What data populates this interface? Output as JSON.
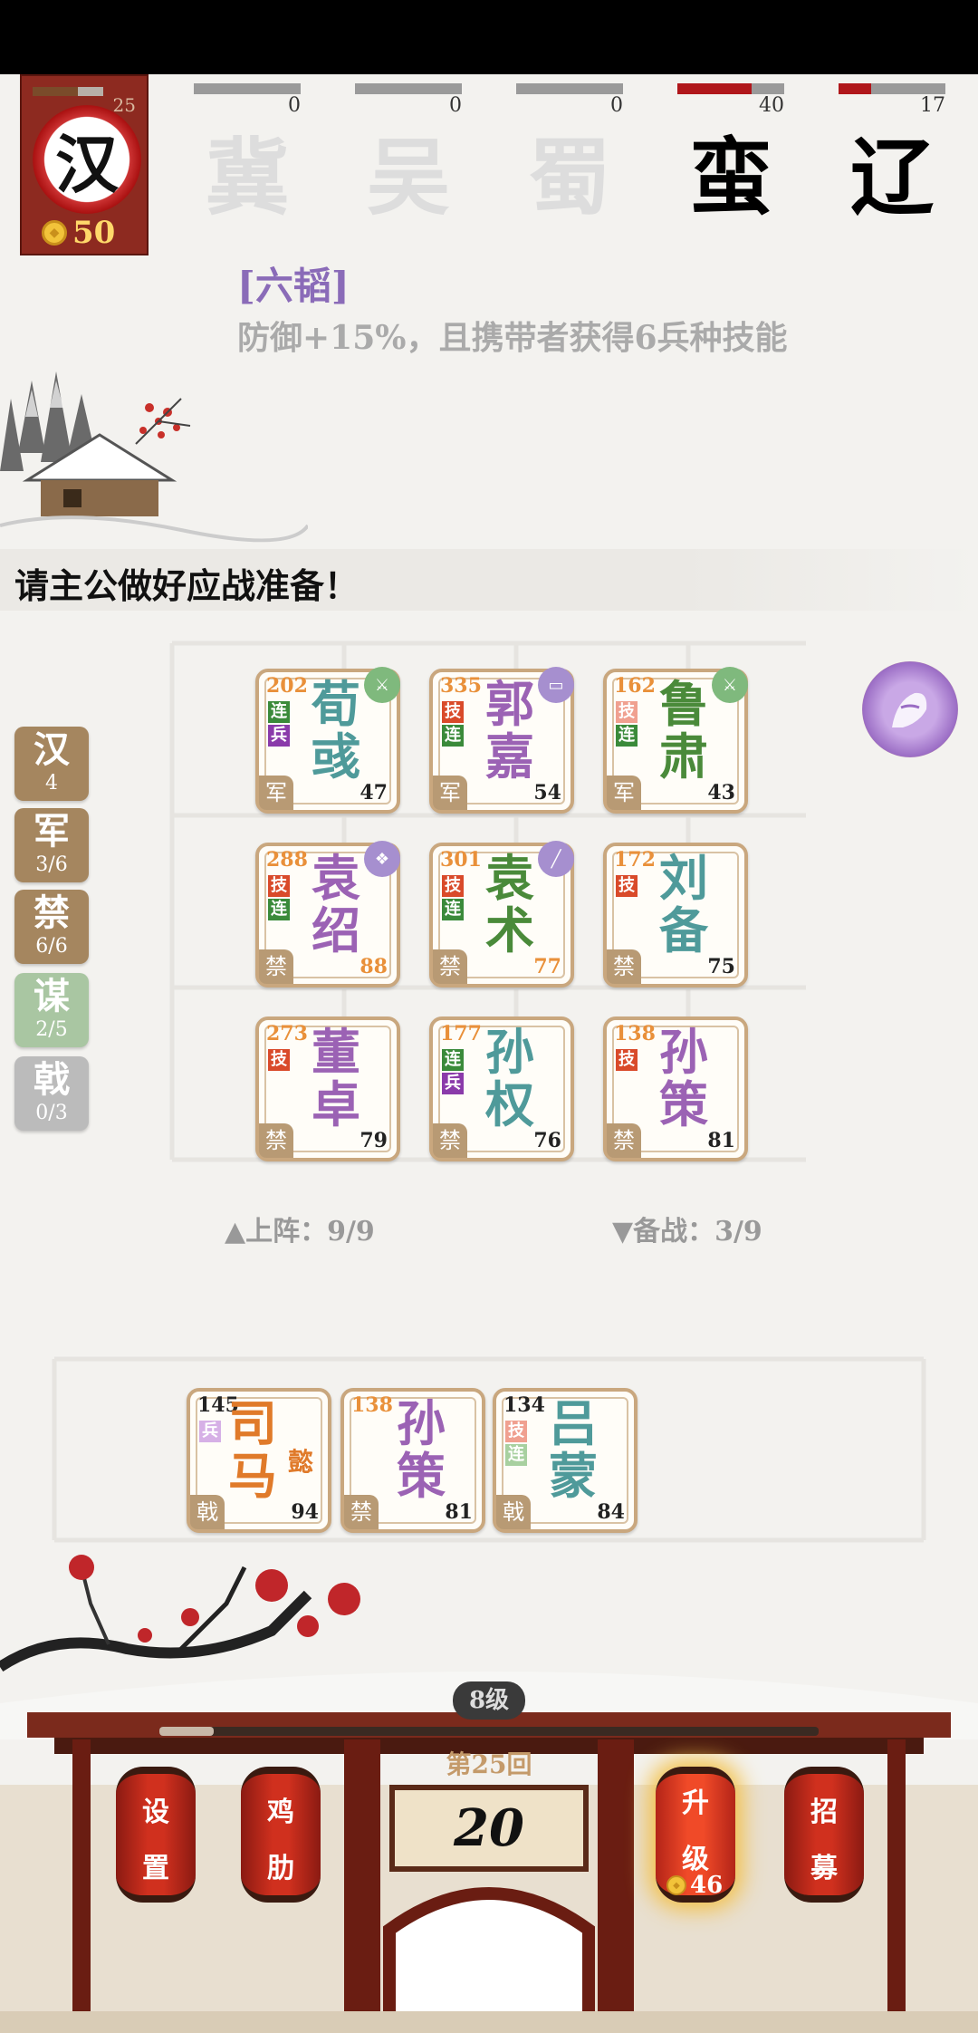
{
  "player": {
    "faction": "汉",
    "level": "25",
    "gold": "50"
  },
  "factions": [
    {
      "name": "冀",
      "score": "0",
      "active": false,
      "progress": 0
    },
    {
      "name": "吴",
      "score": "0",
      "active": false,
      "progress": 0
    },
    {
      "name": "蜀",
      "score": "0",
      "active": false,
      "progress": 0
    },
    {
      "name": "蛮",
      "score": "40",
      "active": true,
      "progress": 0.7
    },
    {
      "name": "辽",
      "score": "17",
      "active": true,
      "progress": 0.3
    }
  ],
  "skill": {
    "title": "[六韬]",
    "desc": "防御+15%，且携带者获得6兵种技能"
  },
  "prompt": "请主公做好应战准备！",
  "type_tags": [
    {
      "name": "汉",
      "count": "4"
    },
    {
      "name": "军",
      "count": "3/6"
    },
    {
      "name": "禁",
      "count": "6/6"
    },
    {
      "name": "谋",
      "count": "2/5"
    },
    {
      "name": "戟",
      "count": "0/3"
    }
  ],
  "board": [
    {
      "n1": "荀",
      "n2": "彧",
      "cost": "202",
      "lvl": "47",
      "type": "军",
      "color": "teal",
      "skills": [
        "连",
        "兵"
      ]
    },
    {
      "n1": "郭",
      "n2": "嘉",
      "cost": "335",
      "lvl": "54",
      "type": "军",
      "color": "purple",
      "skills": [
        "技",
        "连"
      ]
    },
    {
      "n1": "鲁",
      "n2": "肃",
      "cost": "162",
      "lvl": "43",
      "type": "军",
      "color": "green",
      "skills": [
        "技",
        "连"
      ]
    },
    {
      "n1": "袁",
      "n2": "绍",
      "cost": "288",
      "lvl": "88",
      "type": "禁",
      "color": "purple",
      "skills": [
        "技",
        "连"
      ]
    },
    {
      "n1": "袁",
      "n2": "术",
      "cost": "301",
      "lvl": "77",
      "type": "禁",
      "color": "green",
      "skills": [
        "技",
        "连"
      ]
    },
    {
      "n1": "刘",
      "n2": "备",
      "cost": "172",
      "lvl": "75",
      "type": "禁",
      "color": "teal",
      "skills": [
        "技"
      ]
    },
    {
      "n1": "董",
      "n2": "卓",
      "cost": "273",
      "lvl": "79",
      "type": "禁",
      "color": "purple",
      "skills": [
        "技"
      ]
    },
    {
      "n1": "孙",
      "n2": "权",
      "cost": "177",
      "lvl": "76",
      "type": "禁",
      "color": "teal",
      "skills": [
        "连",
        "兵"
      ]
    },
    {
      "n1": "孙",
      "n2": "策",
      "cost": "138",
      "lvl": "81",
      "type": "禁",
      "color": "purple",
      "skills": [
        "技"
      ]
    }
  ],
  "stats": {
    "deployed": "▲上阵：9/9",
    "reserve": "▼备战：3/9"
  },
  "bench": [
    {
      "n1": "司",
      "n2": "马",
      "extra": "懿",
      "cost": "145",
      "lvl": "94",
      "type": "戟",
      "color": "orange",
      "skills": [
        "兵"
      ]
    },
    {
      "n1": "孙",
      "n2": "策",
      "cost": "138",
      "lvl": "81",
      "type": "禁",
      "color": "purple",
      "skills": []
    },
    {
      "n1": "吕",
      "n2": "蒙",
      "cost": "134",
      "lvl": "84",
      "type": "戟",
      "color": "teal",
      "skills": [
        "技",
        "连"
      ]
    }
  ],
  "palace": {
    "level": "8级",
    "round": "第25回",
    "timer": "20",
    "settings": [
      "设",
      "置"
    ],
    "rib": [
      "鸡",
      "肋"
    ],
    "upgrade": [
      "升",
      "级"
    ],
    "upgrade_cost": "46",
    "recruit": [
      "招",
      "募"
    ]
  }
}
